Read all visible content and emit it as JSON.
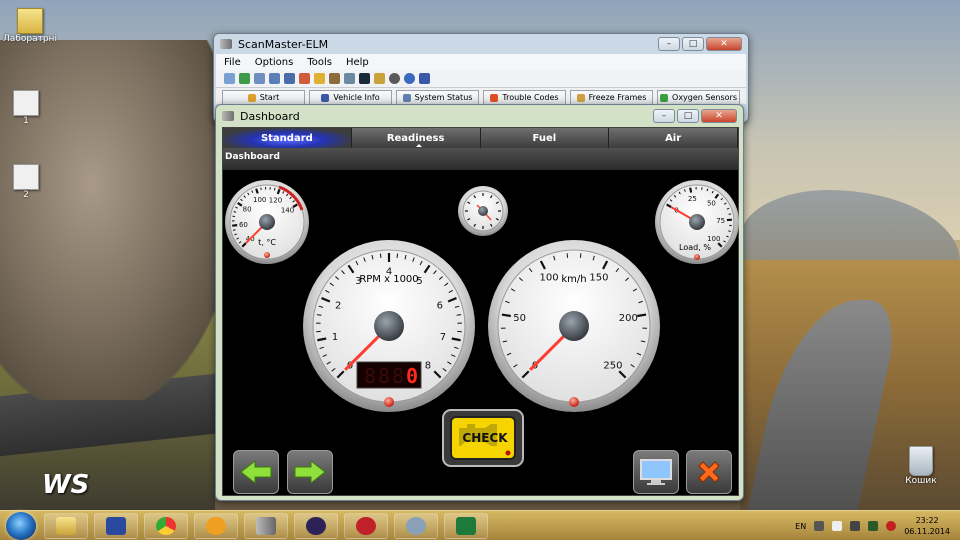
{
  "desktop": {
    "icons": [
      {
        "label": "Лаборатрні"
      },
      {
        "label": "1"
      },
      {
        "label": "2"
      },
      {
        "label": "Кошик"
      }
    ],
    "logo": "WS"
  },
  "main_window": {
    "title": "ScanMaster-ELM",
    "menu": [
      "File",
      "Options",
      "Tools",
      "Help"
    ],
    "tabs": [
      "Start",
      "Vehicle Info",
      "System Status",
      "Trouble Codes",
      "Freeze Frames",
      "Oxygen Sensors"
    ]
  },
  "dashboard_window": {
    "title": "Dashboard",
    "tabs": [
      "Standard",
      "Readiness",
      "Fuel",
      "Air"
    ],
    "active_tab": "Standard",
    "header": "Dashboard",
    "temp_gauge": {
      "label": "t, °C",
      "ticks": [
        "40",
        "60",
        "80",
        "100",
        "120",
        "140"
      ],
      "value": 40
    },
    "rpm_gauge": {
      "label": "RPM x 1000",
      "ticks": [
        "0",
        "1",
        "2",
        "3",
        "4",
        "5",
        "6",
        "7",
        "8"
      ],
      "value": 0,
      "readout": "0"
    },
    "speed_gauge": {
      "label": "km/h",
      "ticks": [
        "0",
        "50",
        "100",
        "150",
        "200",
        "250"
      ],
      "value": 0
    },
    "load_gauge": {
      "label": "Load, %",
      "ticks": [
        "0",
        "25",
        "50",
        "75",
        "100"
      ],
      "value": 0
    },
    "check_engine": "CHECK"
  },
  "taskbar": {
    "language": "EN",
    "time": "23:22",
    "date": "06.11.2014"
  },
  "colors": {
    "accent": "#2433b5",
    "needle": "#ff3b2f",
    "check_yellow": "#f6d400",
    "digit_red": "#ff2a1a",
    "arrow_green": "#8fe03a",
    "close_orange": "#ff6a1a"
  }
}
